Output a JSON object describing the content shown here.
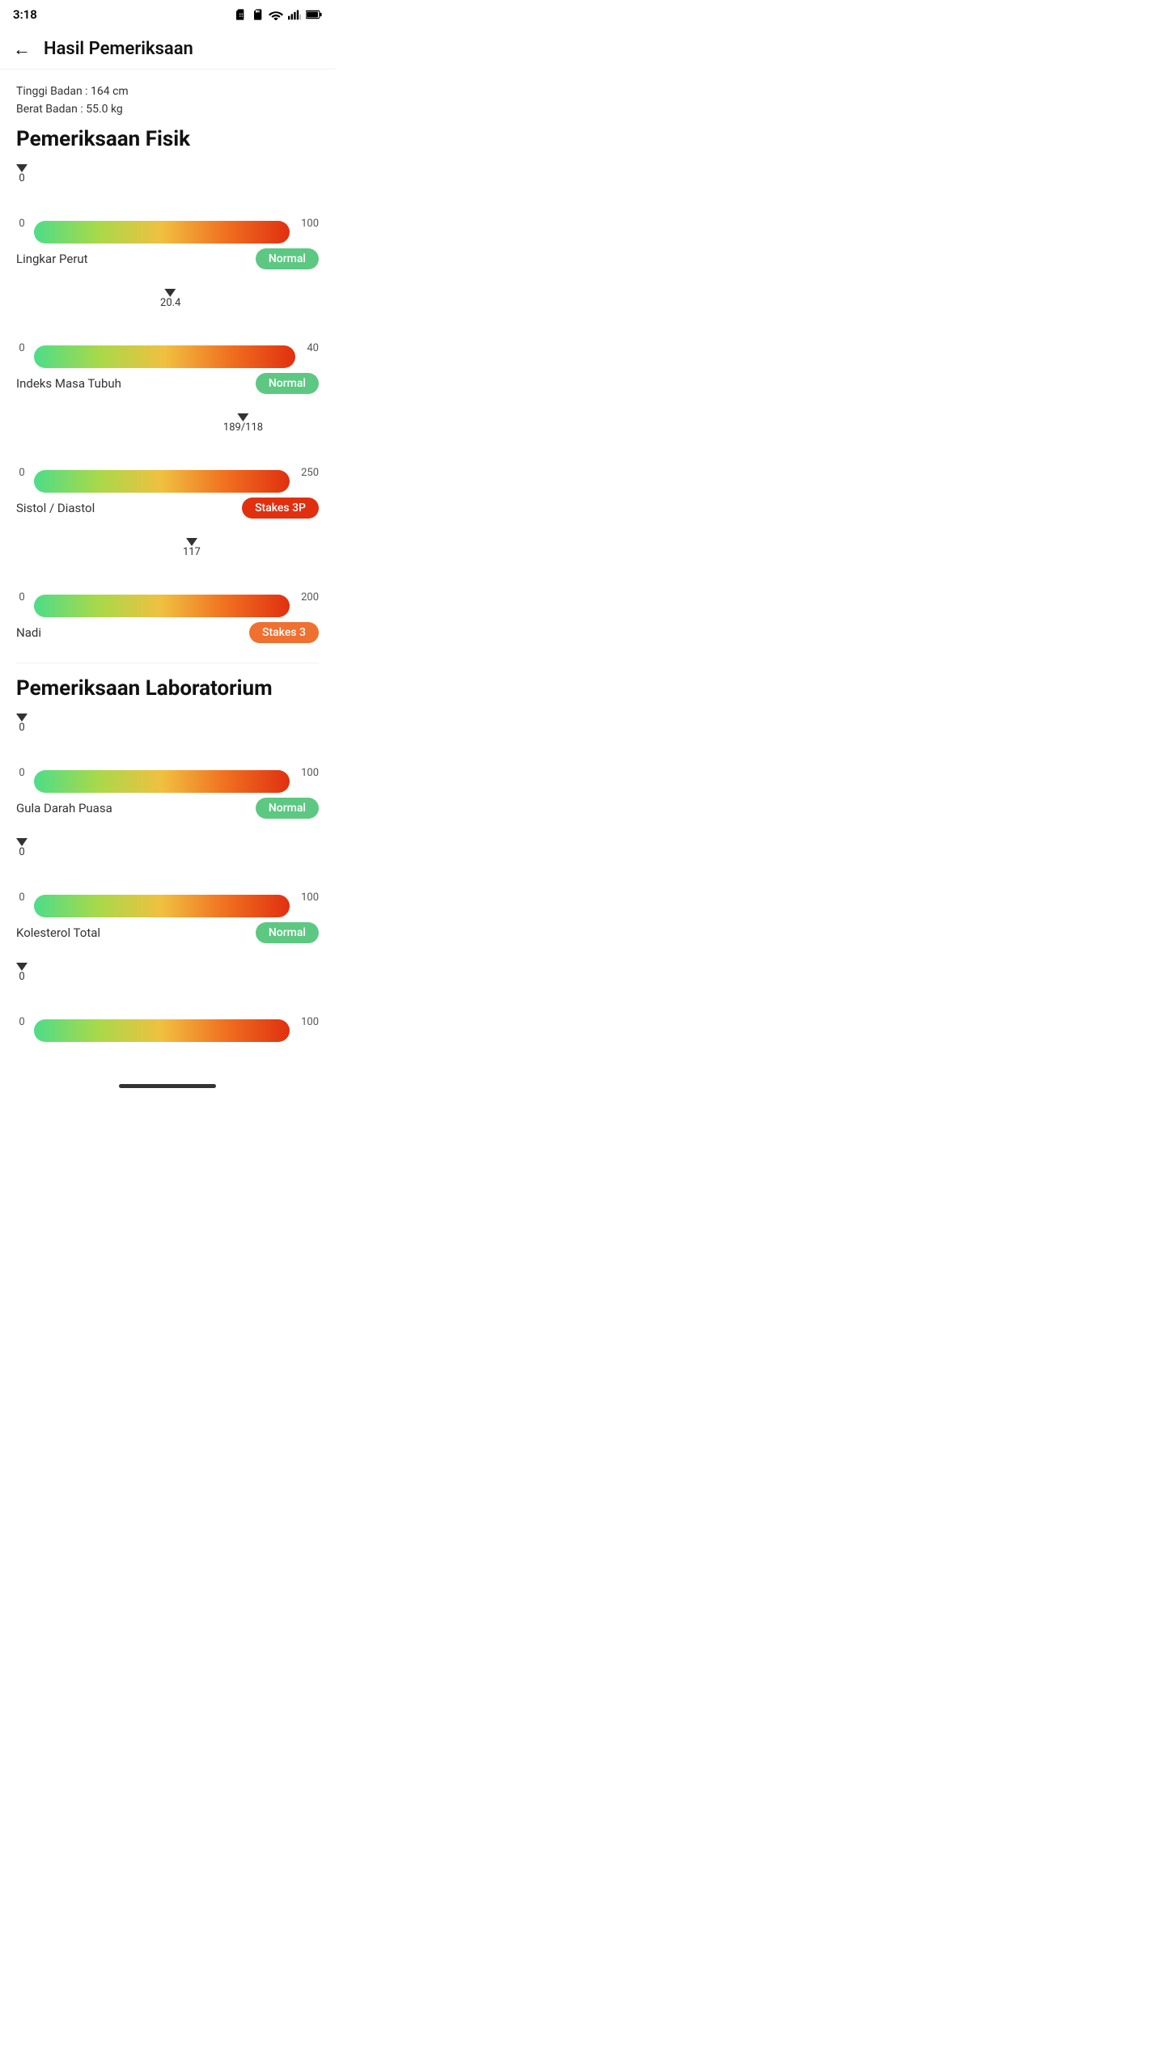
{
  "statusBar": {
    "time": "3:18",
    "icons": [
      "sim",
      "sd",
      "wifi",
      "signal",
      "battery"
    ]
  },
  "header": {
    "backLabel": "←",
    "title": "Hasil Pemeriksaan"
  },
  "patient": {
    "height": "Tinggi Badan : 164 cm",
    "weight": "Berat Badan : 55.0 kg"
  },
  "sections": [
    {
      "id": "pemeriksaan-fisik",
      "title": "Pemeriksaan Fisik",
      "items": [
        {
          "id": "lingkar-perut",
          "name": "Lingkar Perut",
          "min": "0",
          "max": "100",
          "value": null,
          "indicatorPct": 0,
          "indicatorLabel": "0",
          "showIndicator": true,
          "indicatorLeft": 0,
          "barPct": 100,
          "statusLabel": "Normal",
          "statusClass": "badge-normal"
        },
        {
          "id": "indeks-masa-tubuh",
          "name": "Indeks Masa Tubuh",
          "min": "0",
          "max": "40",
          "value": "20.4",
          "indicatorLabel": "20.4",
          "showIndicator": true,
          "indicatorLeft": 51,
          "barPct": 100,
          "statusLabel": "Normal",
          "statusClass": "badge-normal"
        },
        {
          "id": "sistol-diastol",
          "name": "Sistol / Diastol",
          "min": "0",
          "max": "250",
          "value": "189/118",
          "indicatorLabel": "189/118",
          "showIndicator": true,
          "indicatorLeft": 75,
          "barPct": 100,
          "statusLabel": "Stakes 3P",
          "statusClass": "badge-stakes3"
        },
        {
          "id": "nadi",
          "name": "Nadi",
          "min": "0",
          "max": "200",
          "value": "117",
          "indicatorLabel": "117",
          "showIndicator": true,
          "indicatorLeft": 58,
          "barPct": 100,
          "statusLabel": "Stakes 3",
          "statusClass": "badge-warning"
        }
      ]
    },
    {
      "id": "pemeriksaan-laboratorium",
      "title": "Pemeriksaan Laboratorium",
      "items": [
        {
          "id": "gula-darah-puasa",
          "name": "Gula Darah Puasa",
          "min": "0",
          "max": "100",
          "value": null,
          "indicatorLabel": "0",
          "showIndicator": true,
          "indicatorLeft": 0,
          "barPct": 100,
          "statusLabel": "Normal",
          "statusClass": "badge-normal"
        },
        {
          "id": "kolesterol-total",
          "name": "Kolesterol Total",
          "min": "0",
          "max": "100",
          "value": null,
          "indicatorLabel": "0",
          "showIndicator": true,
          "indicatorLeft": 0,
          "barPct": 100,
          "statusLabel": "Normal",
          "statusClass": "badge-normal"
        },
        {
          "id": "item-3",
          "name": "",
          "min": "0",
          "max": "100",
          "value": null,
          "indicatorLabel": "0",
          "showIndicator": true,
          "indicatorLeft": 0,
          "barPct": 100,
          "statusLabel": "",
          "statusClass": ""
        }
      ]
    }
  ]
}
